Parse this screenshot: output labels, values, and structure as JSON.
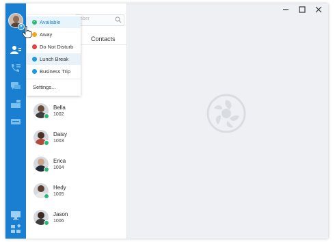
{
  "sidebar_search": {
    "placeholder": "mber"
  },
  "tabs": {
    "contacts": "Contacts"
  },
  "status_menu": {
    "items": [
      {
        "label": "Available",
        "color": "#2bb673",
        "icon": "check-icon"
      },
      {
        "label": "Away",
        "color": "#f5a623",
        "icon": "clock-icon"
      },
      {
        "label": "Do Not Disturb",
        "color": "#e53935",
        "icon": "minus-icon"
      },
      {
        "label": "Lunch Break",
        "color": "#1a9be0",
        "icon": "utensils-icon"
      },
      {
        "label": "Business Trip",
        "color": "#1a9be0",
        "icon": "briefcase-icon"
      }
    ],
    "settings": "Settings..."
  },
  "contacts": [
    {
      "name": "Bella",
      "ext": "1002"
    },
    {
      "name": "Daisy",
      "ext": "1003"
    },
    {
      "name": "Erica",
      "ext": "1004"
    },
    {
      "name": "Hedy",
      "ext": "1005"
    },
    {
      "name": "Jason",
      "ext": "1006"
    }
  ],
  "colors": {
    "accent": "#1a7fd0",
    "available": "#2bb673"
  }
}
